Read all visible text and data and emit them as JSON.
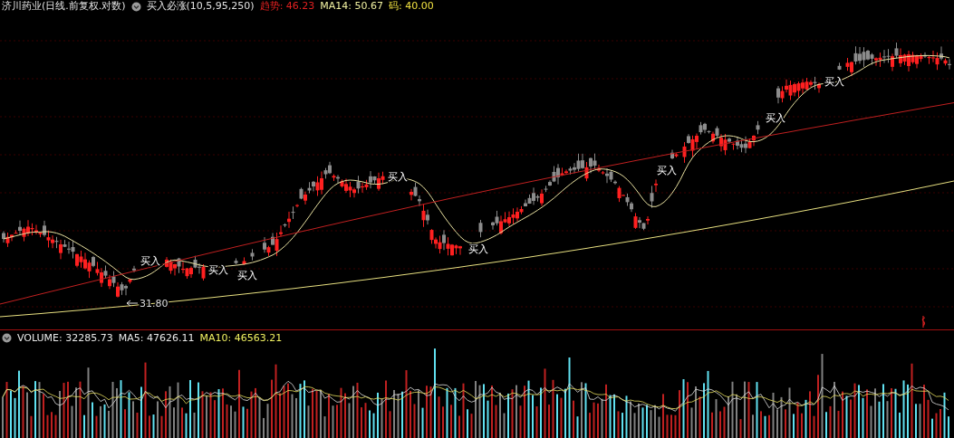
{
  "chart_header": {
    "title": "济川药业(日线.前复权.对数)",
    "indicator": "买入必涨(10,5,95,250)",
    "values": [
      {
        "text": "趋势: 46.23",
        "color": "#e02020"
      },
      {
        "text": "MA14: 50.67",
        "color": "#f0f0a0"
      },
      {
        "text": "码: 40.00",
        "color": "#f0e040"
      }
    ]
  },
  "signals": [
    {
      "text": "买入"
    },
    {
      "text": "买入"
    },
    {
      "text": "买入"
    },
    {
      "text": "买入"
    },
    {
      "text": "买入"
    },
    {
      "text": "买入"
    },
    {
      "text": "买入"
    },
    {
      "text": "买入"
    }
  ],
  "low_marker": {
    "text": "31.80"
  },
  "volume_header": {
    "values": [
      {
        "text": "VOLUME: 32285.73",
        "color": "#e8e8e8"
      },
      {
        "text": "MA5: 47626.11",
        "color": "#e8e8e8"
      },
      {
        "text": "MA10: 46563.21",
        "color": "#f0f060"
      }
    ]
  }
}
